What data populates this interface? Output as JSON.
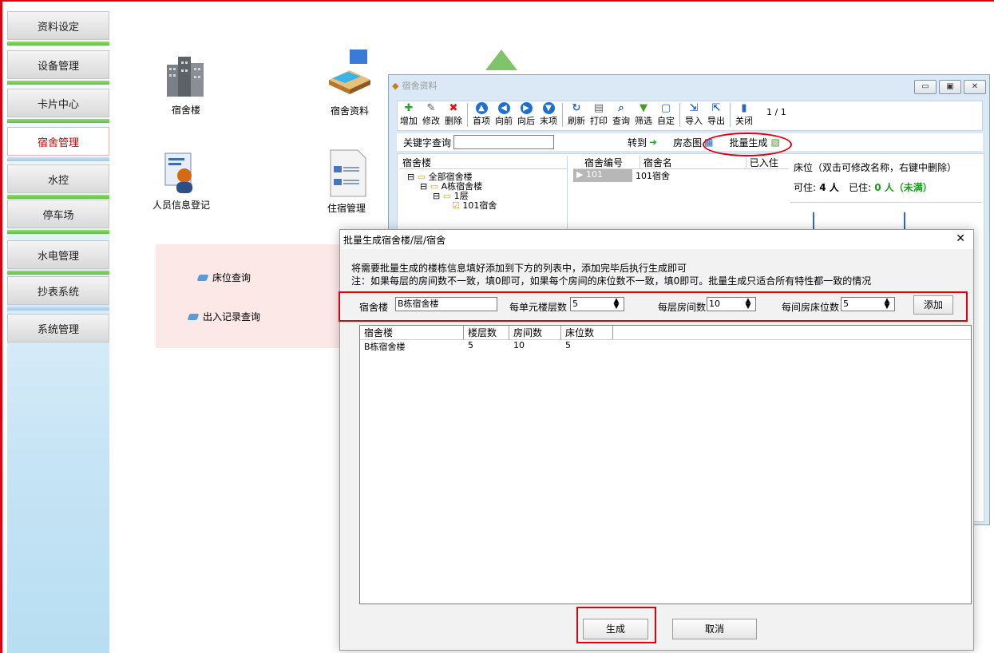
{
  "sidebar": {
    "items": [
      {
        "label": "资料设定"
      },
      {
        "label": "设备管理"
      },
      {
        "label": "卡片中心"
      },
      {
        "label": "宿舍管理",
        "active": true
      },
      {
        "label": "水控"
      },
      {
        "label": "停车场"
      },
      {
        "label": "水电管理"
      },
      {
        "label": "抄表系统"
      },
      {
        "label": "系统管理"
      }
    ]
  },
  "desktop": {
    "icons": [
      {
        "label": "宿舍楼",
        "icon": "buildings-icon"
      },
      {
        "label": "宿舍资料",
        "icon": "room-bed-icon"
      },
      {
        "label": "人员信息登记",
        "icon": "person-document-icon"
      },
      {
        "label": "住宿管理",
        "icon": "id-card-icon"
      }
    ],
    "quick_links": [
      {
        "label": "床位查询"
      },
      {
        "label": "出入记录查询"
      }
    ]
  },
  "dorm_window": {
    "title": "宿舍资料",
    "toolbar": [
      {
        "label": "增加",
        "icon": "plus-icon"
      },
      {
        "label": "修改",
        "icon": "edit-icon"
      },
      {
        "label": "删除",
        "icon": "delete-icon"
      },
      {
        "label": "首项",
        "icon": "first-icon"
      },
      {
        "label": "向前",
        "icon": "prev-icon"
      },
      {
        "label": "向后",
        "icon": "next-icon"
      },
      {
        "label": "末项",
        "icon": "last-icon"
      },
      {
        "label": "刷新",
        "icon": "refresh-icon"
      },
      {
        "label": "打印",
        "icon": "print-icon"
      },
      {
        "label": "查询",
        "icon": "search-icon"
      },
      {
        "label": "筛选",
        "icon": "filter-icon"
      },
      {
        "label": "自定",
        "icon": "custom-icon"
      },
      {
        "label": "导入",
        "icon": "import-icon"
      },
      {
        "label": "导出",
        "icon": "export-icon"
      },
      {
        "label": "关闭",
        "icon": "close-door-icon"
      }
    ],
    "page_indicator": "1 / 1",
    "search": {
      "keyword_label": "关键字查询",
      "goto_label": "转到",
      "room_map_label": "房态图",
      "batch_label": "批量生成"
    },
    "tree": {
      "header": "宿舍楼",
      "nodes": [
        "全部宿舍楼",
        "A栋宿舍楼",
        "1层",
        "101宿舍"
      ]
    },
    "grid": {
      "columns": [
        "宿舍编号",
        "宿舍名",
        "已入住"
      ],
      "rows": [
        {
          "id": "101",
          "name": "101宿舍",
          "occupied": ""
        }
      ]
    },
    "bed_panel": {
      "title": "床位（双击可修改名称，右键中删除）",
      "available_label": "可住:",
      "available": "4 人",
      "occupied_label": "已住:",
      "occupied": "0 人（未满）"
    }
  },
  "dialog": {
    "title": "批量生成宿舍楼/层/宿舍",
    "note1": "将需要批量生成的楼栋信息填好添加到下方的列表中，添加完毕后执行生成即可",
    "note2": "注：如果每层的房间数不一致，填0即可，如果每个房间的床位数不一致，填0即可。批量生成只适合所有特性都一致的情况",
    "fields": {
      "building_label": "宿舍楼",
      "building_value": "B栋宿舍楼",
      "floors_label": "每单元楼层数",
      "floors_value": "5",
      "rooms_label": "每层房间数",
      "rooms_value": "10",
      "beds_label": "每间房床位数",
      "beds_value": "5",
      "add_label": "添加"
    },
    "list": {
      "columns": [
        "宿舍楼",
        "楼层数",
        "房间数",
        "床位数"
      ],
      "rows": [
        [
          "B栋宿舍楼",
          "5",
          "10",
          "5"
        ]
      ]
    },
    "generate_label": "生成",
    "cancel_label": "取消"
  }
}
